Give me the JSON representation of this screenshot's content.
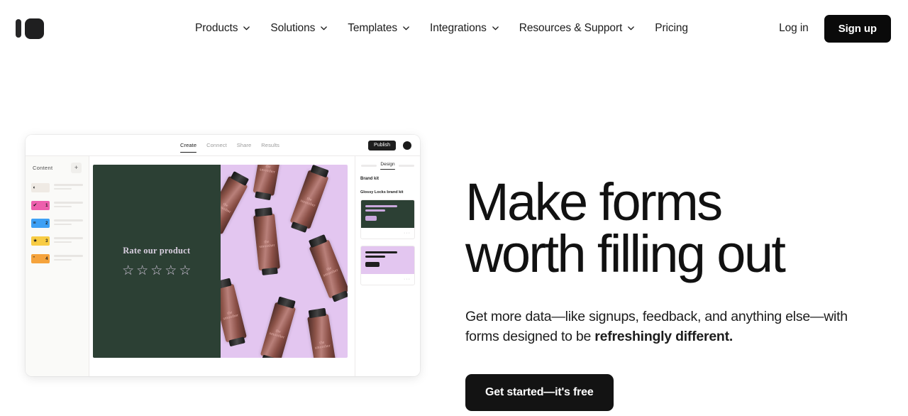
{
  "nav": {
    "logo_name": "typeform-logo",
    "items": [
      {
        "label": "Products",
        "has_caret": true
      },
      {
        "label": "Solutions",
        "has_caret": true
      },
      {
        "label": "Templates",
        "has_caret": true
      },
      {
        "label": "Integrations",
        "has_caret": true
      },
      {
        "label": "Resources & Support",
        "has_caret": true
      },
      {
        "label": "Pricing",
        "has_caret": false
      }
    ],
    "login_label": "Log in",
    "signup_label": "Sign up"
  },
  "hero": {
    "headline_line1": "Make forms",
    "headline_line2": "worth filling out",
    "subhead_plain": "Get more data—like signups, feedback, and anything else—with forms designed to be ",
    "subhead_bold": "refreshingly different.",
    "cta_label": "Get started—it's free"
  },
  "mockup": {
    "tabs": [
      {
        "label": "Create",
        "active": true
      },
      {
        "label": "Connect",
        "active": false
      },
      {
        "label": "Share",
        "active": false
      },
      {
        "label": "Results",
        "active": false
      }
    ],
    "publish_label": "Publish",
    "avatar_name": "user-avatar",
    "sidebar": {
      "title": "Content",
      "add_label": "+",
      "items": [
        {
          "num": "",
          "icon": "◐",
          "color": "#efeae4",
          "label": "welcome-screen-item"
        },
        {
          "num": "1",
          "icon": "✔",
          "color": "#ed5fad",
          "label": "multiple-choice-item"
        },
        {
          "num": "2",
          "icon": "≡",
          "color": "#3da0f5",
          "label": "short-text-item"
        },
        {
          "num": "3",
          "icon": "★",
          "color": "#f8cc44",
          "label": "rating-item"
        },
        {
          "num": "4",
          "icon": "”",
          "color": "#f5a33c",
          "label": "opinion-scale-item"
        }
      ]
    },
    "canvas": {
      "question": "Rate our product",
      "star_count": 5,
      "star_glyph": "☆",
      "bottle_label_line1": "the",
      "bottle_label_line2": "smoother",
      "bg_dark": "#2c4034",
      "bg_light": "#e3c6f0"
    },
    "panel": {
      "active_tab": "Design",
      "heading": "Brand kit",
      "subheading": "Glossy Locks brand kit",
      "cards": [
        {
          "name": "brand-kit-card-dark",
          "menu": "···"
        },
        {
          "name": "brand-kit-card-light",
          "menu": "···"
        }
      ]
    }
  }
}
